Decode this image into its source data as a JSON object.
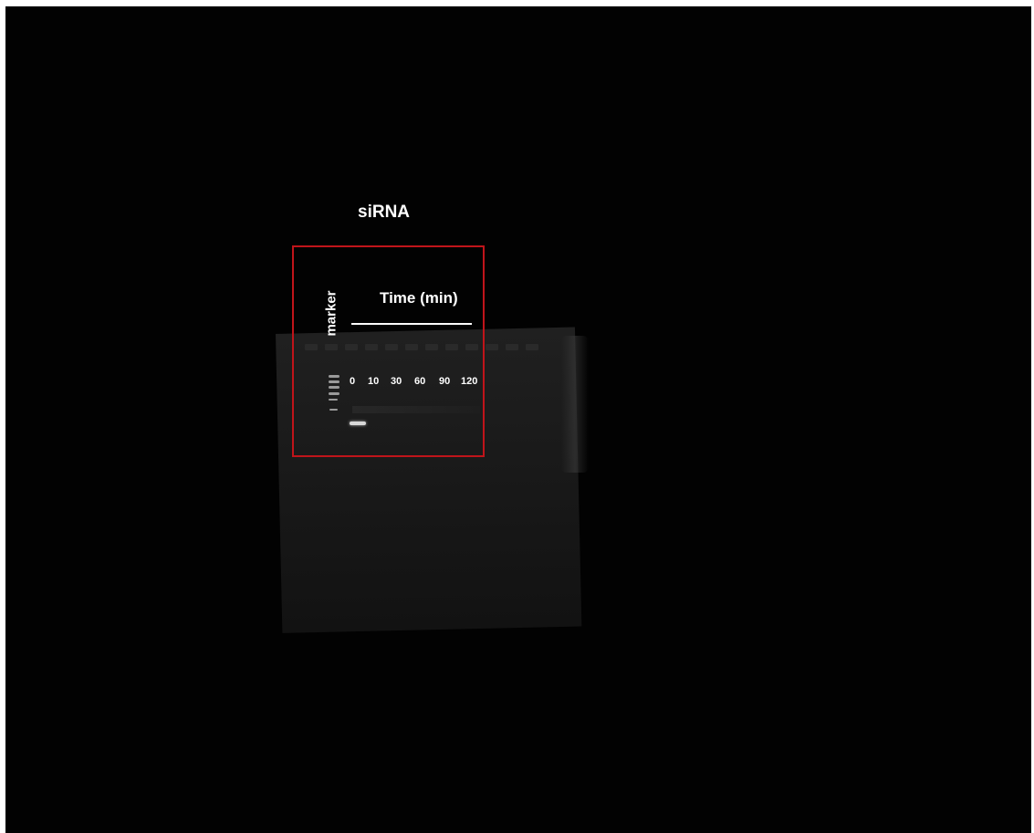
{
  "figure": {
    "title": "siRNA",
    "marker_label": "marker",
    "time_label": "Time (min)",
    "lanes": [
      "0",
      "10",
      "30",
      "60",
      "90",
      "120"
    ]
  },
  "colors": {
    "background": "#020202",
    "gel": "#1b1b1b",
    "highlight_box": "#c0141a",
    "text": "#ffffff"
  }
}
